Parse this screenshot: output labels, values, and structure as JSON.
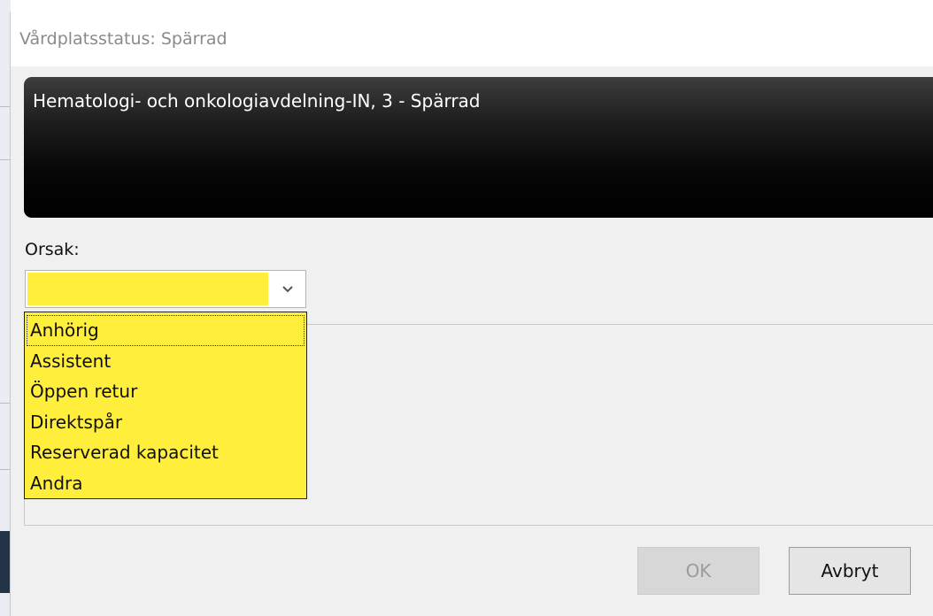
{
  "window": {
    "title": "Vårdplatsstatus: Spärrad"
  },
  "header": {
    "text": "Hematologi- och onkologiavdelning-IN, 3 - Spärrad"
  },
  "reason": {
    "label": "Orsak:",
    "selected_value": "",
    "highlight_color": "#ffee3c",
    "options": [
      "Anhörig",
      "Assistent",
      "Öppen retur",
      "Direktspår",
      "Reserverad kapacitet",
      "Andra"
    ],
    "focused_option": "Anhörig"
  },
  "buttons": {
    "ok_label": "OK",
    "ok_enabled": false,
    "cancel_label": "Avbryt"
  },
  "icons": {
    "dropdown_arrow": "chevron-down-icon"
  }
}
